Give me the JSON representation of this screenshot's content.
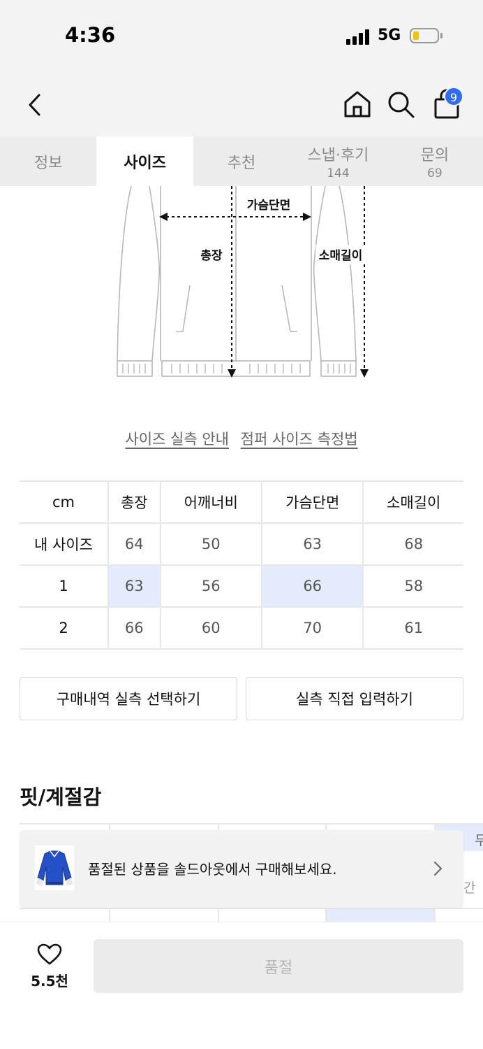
{
  "status": {
    "time": "4:36",
    "network": "5G"
  },
  "nav": {
    "cart_count": "9",
    "icons": [
      "back-icon",
      "home-icon",
      "search-icon",
      "bag-icon"
    ]
  },
  "tabs": [
    {
      "label": "정보",
      "count": ""
    },
    {
      "label": "사이즈",
      "count": ""
    },
    {
      "label": "추천",
      "count": ""
    },
    {
      "label": "스냅·후기",
      "count": "144"
    },
    {
      "label": "문의",
      "count": "69"
    }
  ],
  "diagram": {
    "chest": "가슴단면",
    "length": "총장",
    "sleeve": "소매길이"
  },
  "links": {
    "guide": "사이즈 실측 안내",
    "howto": "점퍼 사이즈 측정법"
  },
  "size_table": {
    "header": [
      "cm",
      "총장",
      "어깨너비",
      "가슴단면",
      "소매길이"
    ],
    "rows": [
      [
        "내 사이즈",
        "64",
        "50",
        "63",
        "68"
      ],
      [
        "1",
        "63",
        "56",
        "66",
        "58"
      ],
      [
        "2",
        "66",
        "60",
        "70",
        "61"
      ]
    ]
  },
  "buttons": {
    "history": "구매내역 실측 선택하기",
    "manual": "실측 직접 입력하기"
  },
  "fit_section": {
    "title": "핏/계절감",
    "row1_partial": "두",
    "row2_partial": "간"
  },
  "banner": {
    "text": "품절된 상품을 솔드아웃에서 구매해보세요."
  },
  "bottom": {
    "like_count": "5.5천",
    "soldout_label": "품절"
  },
  "colors": {
    "accent": "#2f6cf6",
    "highlight": "#e3ebfc"
  }
}
